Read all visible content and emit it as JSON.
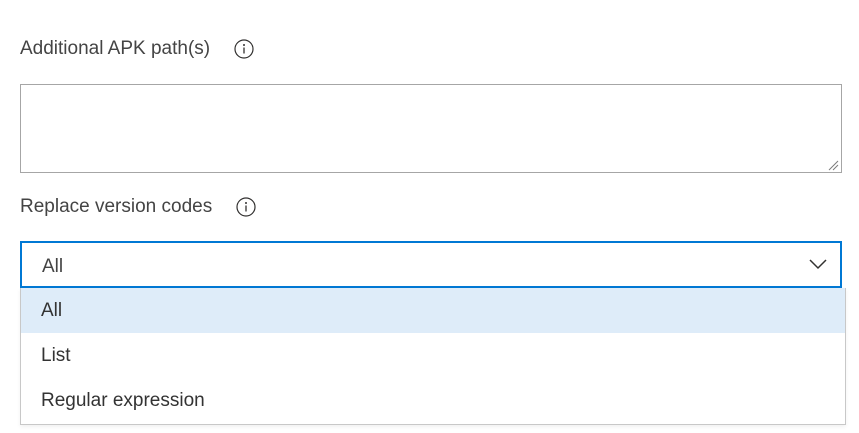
{
  "apk_paths": {
    "label": "Additional APK path(s)",
    "info_icon": "info-icon",
    "value": ""
  },
  "version_codes": {
    "label": "Replace version codes",
    "info_icon": "info-icon",
    "selected": "All",
    "chevron_icon": "chevron-down-icon",
    "options": [
      {
        "label": "All",
        "selected": true
      },
      {
        "label": "List",
        "selected": false
      },
      {
        "label": "Regular expression",
        "selected": false
      }
    ]
  },
  "colors": {
    "focus_border": "#0078d4",
    "selected_option_bg": "#deecf9",
    "input_border": "#a6a6a6"
  }
}
